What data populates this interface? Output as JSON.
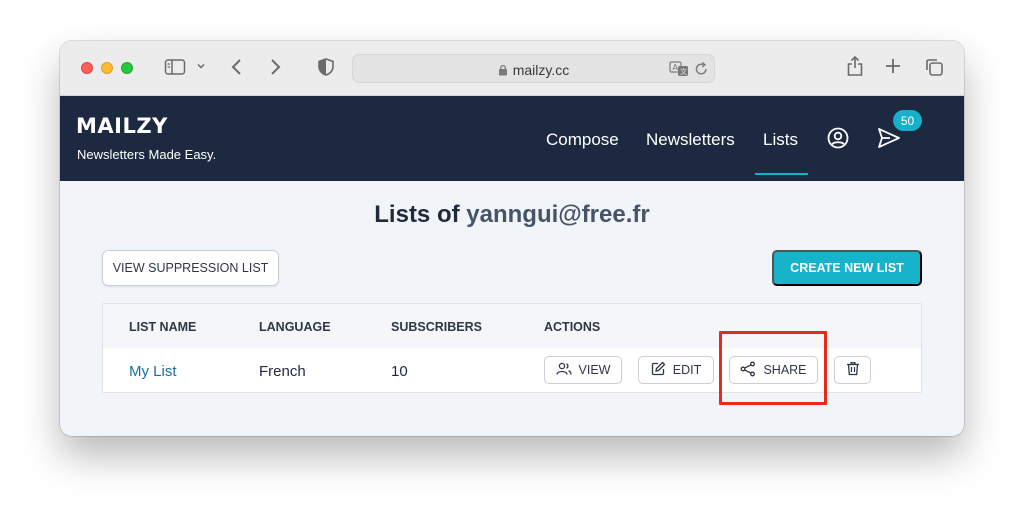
{
  "browser": {
    "url": "mailzy.cc"
  },
  "app": {
    "logo": "MAILZY",
    "tagline": "Newsletters Made Easy.",
    "nav": [
      {
        "label": "Compose"
      },
      {
        "label": "Newsletters"
      },
      {
        "label": "Lists",
        "active": true
      }
    ],
    "notification_count": "50"
  },
  "page": {
    "title_prefix": "Lists of",
    "title_email": "yanngui@free.fr",
    "suppression_button": "VIEW SUPPRESSION LIST",
    "create_button": "CREATE NEW LIST"
  },
  "table": {
    "headers": [
      "LIST NAME",
      "LANGUAGE",
      "SUBSCRIBERS",
      "ACTIONS"
    ],
    "rows": [
      {
        "name": "My List",
        "language": "French",
        "subscribers": "10",
        "actions": {
          "view": "VIEW",
          "edit": "EDIT",
          "share": "SHARE"
        }
      }
    ]
  },
  "colors": {
    "navbar": "#1d2940",
    "accent": "#17b3cb",
    "highlight": "#e8291b"
  }
}
